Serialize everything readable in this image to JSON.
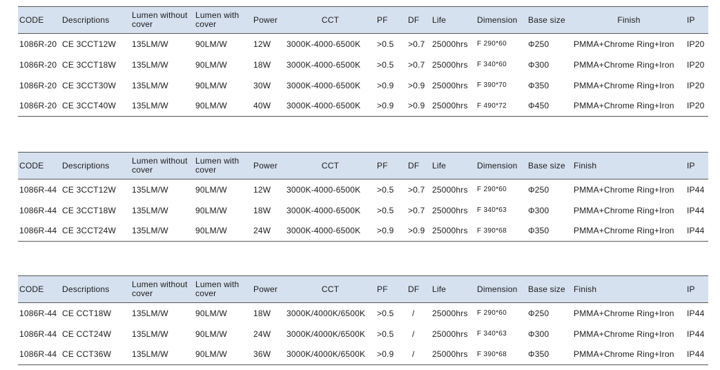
{
  "tables": [
    {
      "headers": [
        "CODE",
        "Descriptions",
        "Lumen without cover",
        "Lumen with cover",
        "Power",
        "CCT",
        "PF",
        "DF",
        "Life",
        "Dimension",
        "Base size",
        "Finish",
        "IP"
      ],
      "rows": [
        [
          "1086R-20",
          "CE 3CCT12W",
          "135LM/W",
          "90LM/W",
          "12W",
          "3000K-4000-6500K",
          ">0.5",
          ">0.7",
          "25000hrs",
          "F 290*60",
          "Φ250",
          "PMMA+Chrome Ring+Iron",
          "IP20"
        ],
        [
          "1086R-20",
          "CE 3CCT18W",
          "135LM/W",
          "90LM/W",
          "18W",
          "3000K-4000-6500K",
          ">0.5",
          ">0.7",
          "25000hrs",
          "F 340*60",
          "Φ300",
          "PMMA+Chrome Ring+Iron",
          "IP20"
        ],
        [
          "1086R-20",
          "CE 3CCT30W",
          "135LM/W",
          "90LM/W",
          "30W",
          "3000K-4000-6500K",
          ">0.9",
          ">0.9",
          "25000hrs",
          "F 390*70",
          "Φ350",
          "PMMA+Chrome Ring+Iron",
          "IP20"
        ],
        [
          "1086R-20",
          "CE 3CCT40W",
          "135LM/W",
          "90LM/W",
          "40W",
          "3000K-4000-6500K",
          ">0.9",
          ">0.9",
          "25000hrs",
          "F 490*72",
          "Φ450",
          "PMMA+Chrome Ring+Iron",
          "IP20"
        ]
      ]
    },
    {
      "headers": [
        "CODE",
        "Descriptions",
        "Lumen without cover",
        "Lumen with cover",
        "Power",
        "CCT",
        "PF",
        "DF",
        "Life",
        "Dimension",
        "Base size",
        "Finish",
        "IP"
      ],
      "rows": [
        [
          "1086R-44",
          "CE 3CCT12W",
          "135LM/W",
          "90LM/W",
          "12W",
          "3000K-4000-6500K",
          ">0.5",
          ">0.7",
          "25000hrs",
          "F 290*60",
          "Φ250",
          "PMMA+Chrome Ring+Iron",
          "IP44"
        ],
        [
          "1086R-44",
          "CE 3CCT18W",
          "135LM/W",
          "90LM/W",
          "18W",
          "3000K-4000-6500K",
          ">0.5",
          ">0.7",
          "25000hrs",
          "F 340*63",
          "Φ300",
          "PMMA+Chrome Ring+Iron",
          "IP44"
        ],
        [
          "1086R-44",
          "CE 3CCT24W",
          "135LM/W",
          "90LM/W",
          "24W",
          "3000K-4000-6500K",
          ">0.9",
          ">0.9",
          "25000hrs",
          "F 390*68",
          "Φ350",
          "PMMA+Chrome Ring+Iron",
          "IP44"
        ]
      ]
    },
    {
      "headers": [
        "CODE",
        "Descriptions",
        "Lumen without cover",
        "Lumen with cover",
        "Power",
        "CCT",
        "PF",
        "DF",
        "Life",
        "Dimension",
        "Base size",
        "Finish",
        "IP"
      ],
      "rows": [
        [
          "1086R-44",
          "CE CCT18W",
          "135LM/W",
          "90LM/W",
          "18W",
          "3000K/4000K/6500K",
          ">0.5",
          "/",
          "25000hrs",
          "F 290*60",
          "Φ250",
          "PMMA+Chrome Ring+Iron",
          "IP44"
        ],
        [
          "1086R-44",
          "CE CCT24W",
          "135LM/W",
          "90LM/W",
          "24W",
          "3000K/4000K/6500K",
          ">0.5",
          "/",
          "25000hrs",
          "F 340*63",
          "Φ300",
          "PMMA+Chrome Ring+Iron",
          "IP44"
        ],
        [
          "1086R-44",
          "CE CCT36W",
          "135LM/W",
          "90LM/W",
          "36W",
          "3000K/4000K/6500K",
          ">0.9",
          "/",
          "25000hrs",
          "F 390*68",
          "Φ350",
          "PMMA+Chrome Ring+Iron",
          "IP44"
        ]
      ]
    }
  ],
  "colors": {
    "header_background": "#d6e1ef",
    "rule_line": "#555555"
  }
}
